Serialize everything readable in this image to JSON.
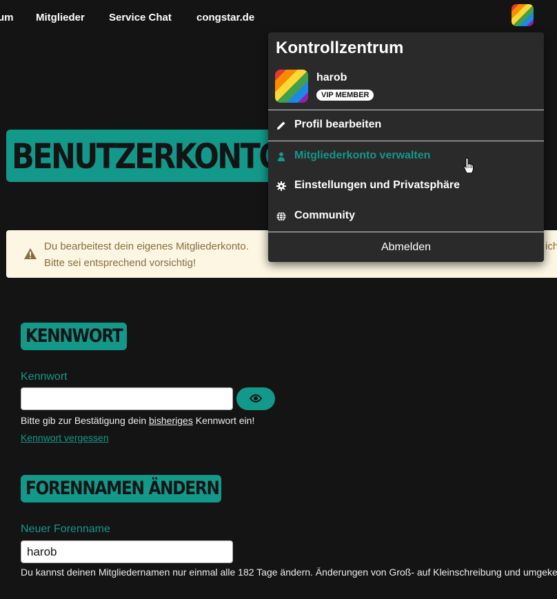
{
  "nav": {
    "items": [
      "um",
      "Mitglieder",
      "Service Chat",
      "congstar.de"
    ]
  },
  "page": {
    "title": "BENUTZERKONTO"
  },
  "warning": {
    "line1": "Du bearbeitest dein eigenes Mitgliederkonto.",
    "line1_tail": "ich",
    "line2": "Bitte sei entsprechend vorsichtig!"
  },
  "password_section": {
    "heading": "KENNWORT",
    "label": "Kennwort",
    "value": "",
    "hint_pre": "Bitte gib zur Bestätigung dein ",
    "hint_underlined": "bisheriges",
    "hint_post": " Kennwort ein!",
    "forgot_link": "Kennwort vergessen"
  },
  "forename_section": {
    "heading": "FORENNAMEN ÄNDERN",
    "label": "Neuer Forenname",
    "value": "harob",
    "hint": "Du kannst deinen Mitgliedernamen nur einmal alle 182 Tage ändern. Änderungen von Groß- auf Kleinschreibung und umgeke"
  },
  "dropdown": {
    "title": "Kontrollzentrum",
    "username": "harob",
    "badge": "VIP MEMBER",
    "items": [
      {
        "label": "Profil bearbeiten",
        "icon": "pencil-icon"
      },
      {
        "label": "Mitgliederkonto verwalten",
        "icon": "user-icon",
        "active": true
      },
      {
        "label": "Einstellungen und Privatsphäre",
        "icon": "gear-icon"
      },
      {
        "label": "Community",
        "icon": "globe-icon"
      }
    ],
    "logout": "Abmelden"
  },
  "colors": {
    "accent": "#12998a",
    "background": "#141414",
    "dropdown_bg": "#2a2a2a",
    "warning_bg": "#fcf6e3",
    "warning_text": "#8a6d3b"
  }
}
